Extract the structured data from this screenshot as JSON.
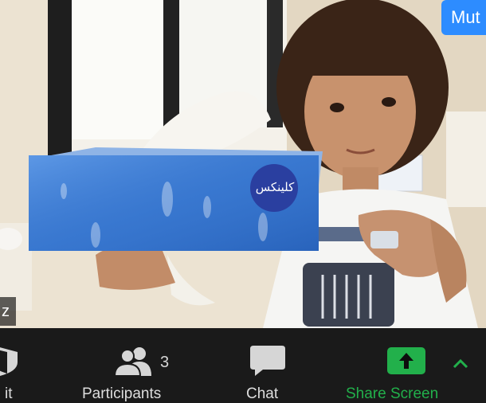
{
  "window": {
    "app": "Zoom meeting"
  },
  "video": {
    "participant_name_fragment": "z",
    "mute_badge_text": "Mut",
    "tissue_brand_text": "كلينكس"
  },
  "toolbar": {
    "security_label": "it",
    "participants_label": "Participants",
    "participants_count": "3",
    "chat_label": "Chat",
    "share_label": "Share Screen",
    "colors": {
      "share_green": "#22b04b",
      "toolbar_bg": "#1a1a1a",
      "mute_blue": "#2d8cff"
    },
    "icons": [
      "shield-icon",
      "participants-icon",
      "chat-icon",
      "share-arrow-icon",
      "chevron-up-icon"
    ]
  }
}
